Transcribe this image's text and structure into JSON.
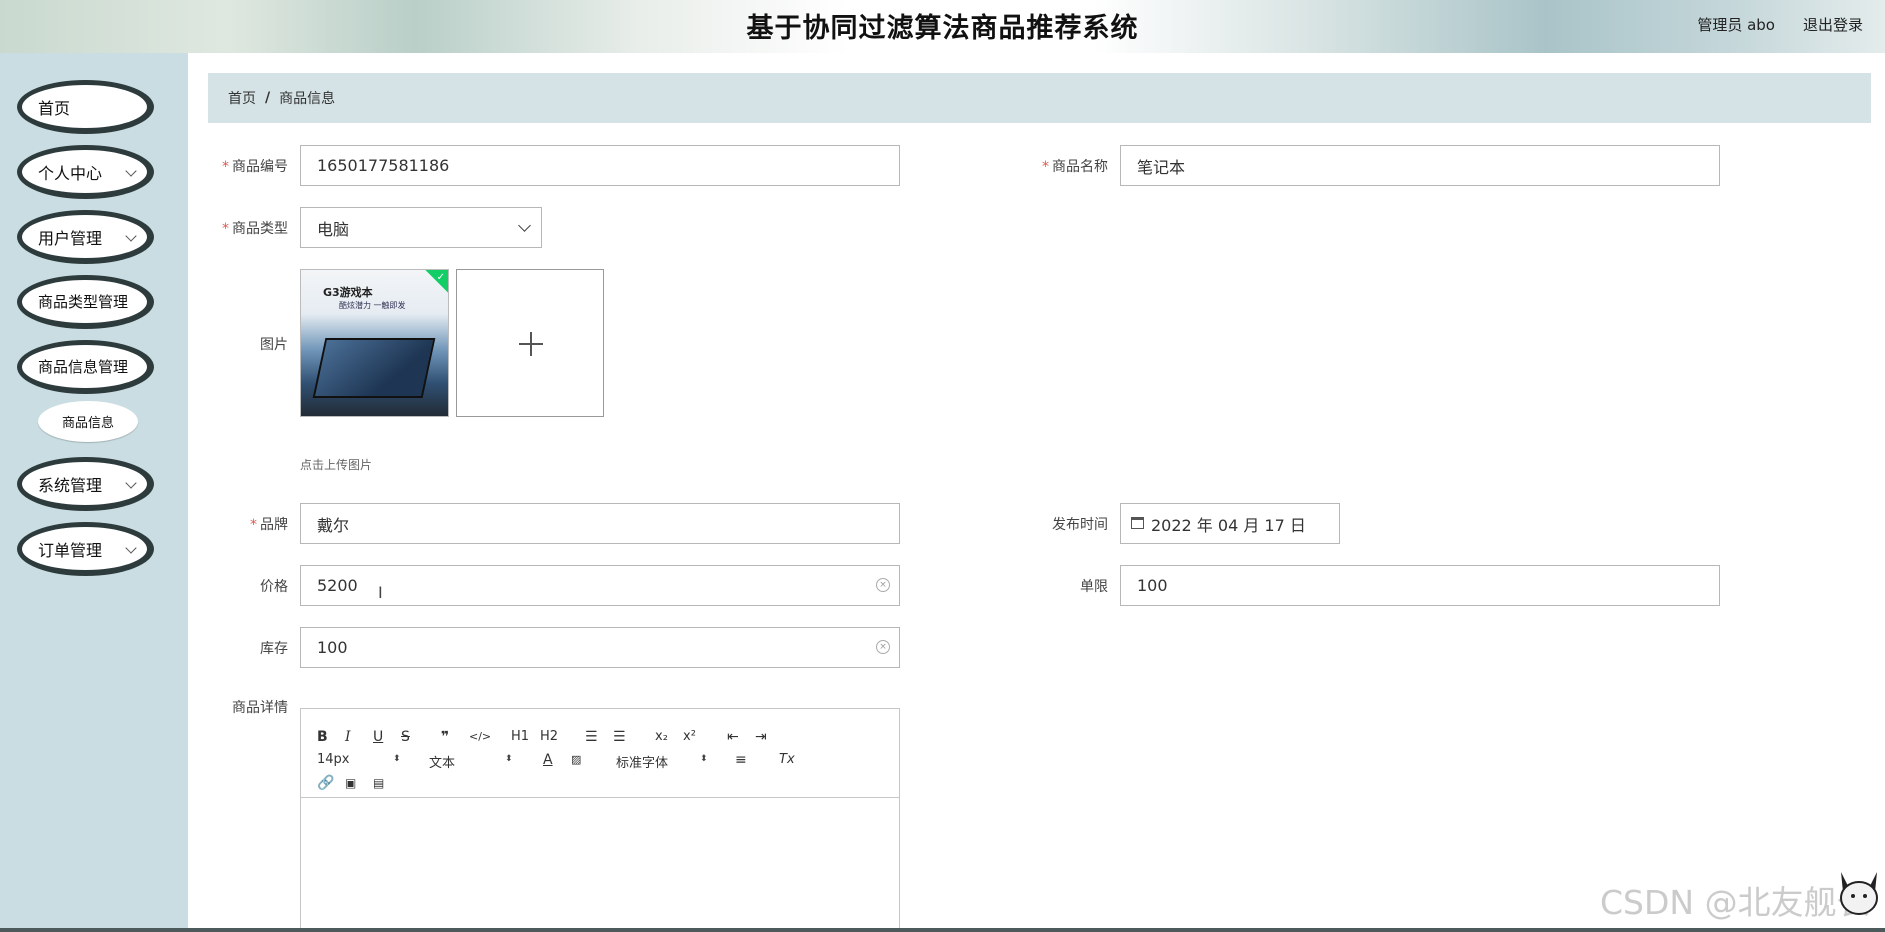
{
  "header": {
    "title": "基于协同过滤算法商品推荐系统",
    "user": "管理员 abo",
    "logout": "退出登录"
  },
  "sidebar": {
    "items": [
      {
        "label": "首页",
        "expandable": false
      },
      {
        "label": "个人中心",
        "expandable": true
      },
      {
        "label": "用户管理",
        "expandable": true
      },
      {
        "label": "商品类型管理",
        "expandable": true
      },
      {
        "label": "商品信息管理",
        "expandable": true
      },
      {
        "label": "系统管理",
        "expandable": true
      },
      {
        "label": "订单管理",
        "expandable": true
      }
    ],
    "sub_item": "商品信息"
  },
  "breadcrumb": {
    "home": "首页",
    "separator": "/",
    "current": "商品信息"
  },
  "form": {
    "code": {
      "label": "商品编号",
      "value": "1650177581186",
      "required": true
    },
    "name": {
      "label": "商品名称",
      "value": "笔记本",
      "required": true
    },
    "type": {
      "label": "商品类型",
      "value": "电脑",
      "required": true
    },
    "image": {
      "label": "图片",
      "hint": "点击上传图片",
      "thumb_title": "G3游戏本",
      "thumb_sub": "酷炫潜力 一触即发"
    },
    "brand": {
      "label": "品牌",
      "value": "戴尔",
      "required": true
    },
    "publish_time": {
      "label": "发布时间",
      "value": "2022 年 04 月 17 日"
    },
    "price": {
      "label": "价格",
      "value": "5200"
    },
    "limit": {
      "label": "单限",
      "value": "100"
    },
    "stock": {
      "label": "库存",
      "value": "100"
    },
    "detail": {
      "label": "商品详情"
    }
  },
  "editor": {
    "font_size": "14px",
    "text_type": "文本",
    "font_family": "标准字体",
    "buttons": [
      "B",
      "I",
      "U",
      "S",
      "❞",
      "</>",
      "H1",
      "H2",
      "ol",
      "ul",
      "x₂",
      "x²",
      "outdent",
      "indent",
      "A",
      "A-bg",
      "align",
      "Tx",
      "link",
      "image",
      "video"
    ]
  },
  "watermark": "CSDN @北友舰长",
  "colors": {
    "sidebar_bg": "#c9dde2",
    "breadcrumb_bg": "#d5e3e6",
    "required": "#e2564e",
    "success": "#13ce66"
  }
}
